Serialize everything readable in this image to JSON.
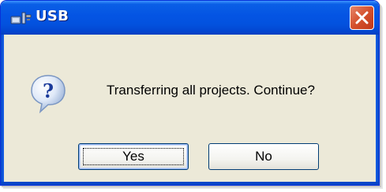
{
  "window": {
    "title": "USB",
    "title_icon": "usb-device-icon",
    "close_icon": "close-icon",
    "accent_color": "#0454e3",
    "close_button_color": "#d4502d"
  },
  "dialog": {
    "message_icon": "question-icon",
    "message": "Transferring all projects. Continue?",
    "buttons": {
      "yes_label": "Yes",
      "no_label": "No",
      "default": "Yes"
    }
  }
}
